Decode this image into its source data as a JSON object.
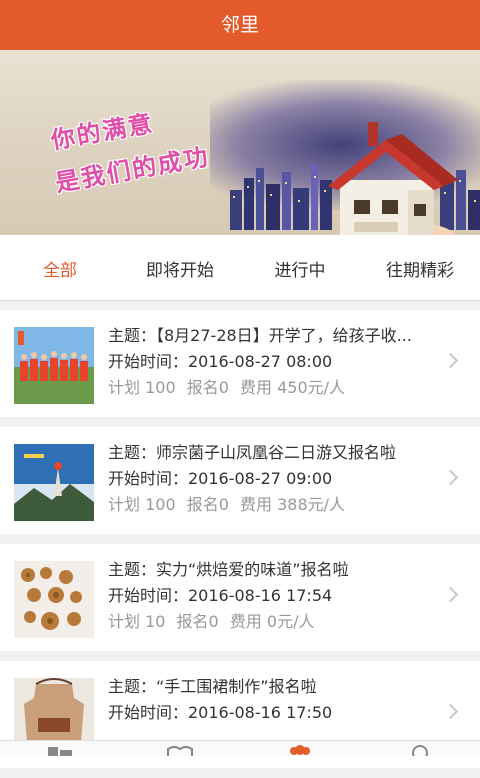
{
  "header": {
    "title": "邻里"
  },
  "banner": {
    "slogan_line1": "你的满意",
    "slogan_line2": "是我们的成功"
  },
  "tabs": [
    {
      "label": "全部",
      "active": true
    },
    {
      "label": "即将开始",
      "active": false
    },
    {
      "label": "进行中",
      "active": false
    },
    {
      "label": "往期精彩",
      "active": false
    }
  ],
  "activities": [
    {
      "title": "主题：【8月27-28日】开学了，给孩子收...",
      "start": "开始时间：2016-08-27 08:00",
      "plan": "计划 100",
      "enrolled": "报名0",
      "fee": "费用 450元/人"
    },
    {
      "title": "主题：师宗菌子山凤凰谷二日游又报名啦",
      "start": "开始时间：2016-08-27 09:00",
      "plan": "计划 100",
      "enrolled": "报名0",
      "fee": "费用 388元/人"
    },
    {
      "title": "主题：实力“烘焙爱的味道”报名啦",
      "start": "开始时间：2016-08-16 17:54",
      "plan": "计划 10",
      "enrolled": "报名0",
      "fee": "费用 0元/人"
    },
    {
      "title": "主题：“手工围裙制作”报名啦",
      "start": "开始时间：2016-08-16 17:50",
      "plan": "",
      "enrolled": "",
      "fee": ""
    }
  ],
  "colors": {
    "brand": "#e35a2b",
    "text": "#333333",
    "muted": "#999999",
    "slogan": "#e04ea8"
  },
  "icons": {
    "chevron": "chevron-right-icon",
    "nav": [
      "building-icon",
      "book-icon",
      "people-icon",
      "profile-icon"
    ]
  }
}
